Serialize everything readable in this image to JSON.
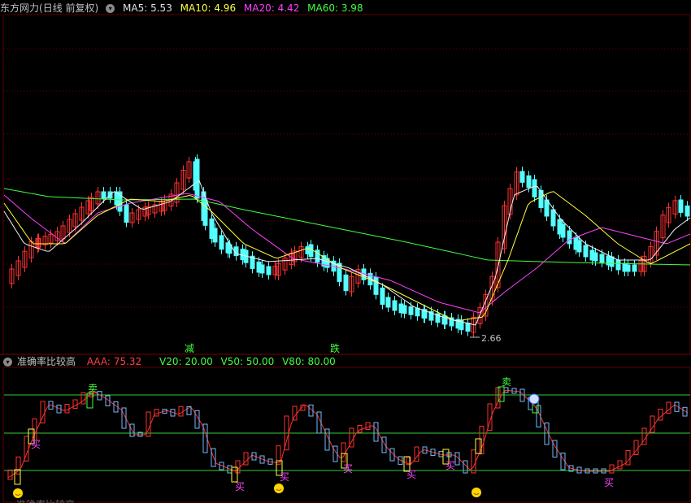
{
  "main_panel": {
    "stock_name": "东方网力",
    "period": "(日线 前复权)",
    "ma_lines": [
      {
        "label": "MA5:",
        "value": "5.53",
        "color": "#e0e0e0"
      },
      {
        "label": "MA10:",
        "value": "4.96",
        "color": "#ffff40"
      },
      {
        "label": "MA20:",
        "value": "4.42",
        "color": "#ff40ff"
      },
      {
        "label": "MA60:",
        "value": "3.98",
        "color": "#40ff40"
      }
    ],
    "low_marker": "2.66",
    "signals": [
      "减",
      "跌"
    ]
  },
  "indicator_panel": {
    "name": "准确率比较高",
    "aaa": {
      "label": "AAA:",
      "value": "75.32",
      "color": "#ff4040"
    },
    "levels": [
      {
        "label": "V20:",
        "value": "20.00"
      },
      {
        "label": "V50:",
        "value": "50.00"
      },
      {
        "label": "V80:",
        "value": "80.00"
      }
    ],
    "buy_label": "买",
    "sell_label": "卖",
    "bottom_text": "准确率比较高"
  },
  "chart_data": [
    {
      "type": "candlestick",
      "title": "东方网力",
      "low_annotation": 2.66,
      "series": [
        {
          "name": "MA5",
          "value": 5.53
        },
        {
          "name": "MA10",
          "value": 4.96
        },
        {
          "name": "MA20",
          "value": 4.42
        },
        {
          "name": "MA60",
          "value": 3.98
        }
      ]
    },
    {
      "type": "line",
      "title": "准确率比较高",
      "series": [
        {
          "name": "AAA",
          "last": 75.32
        }
      ],
      "reference_lines": [
        20,
        50,
        80
      ],
      "ylim": [
        0,
        100
      ]
    }
  ]
}
